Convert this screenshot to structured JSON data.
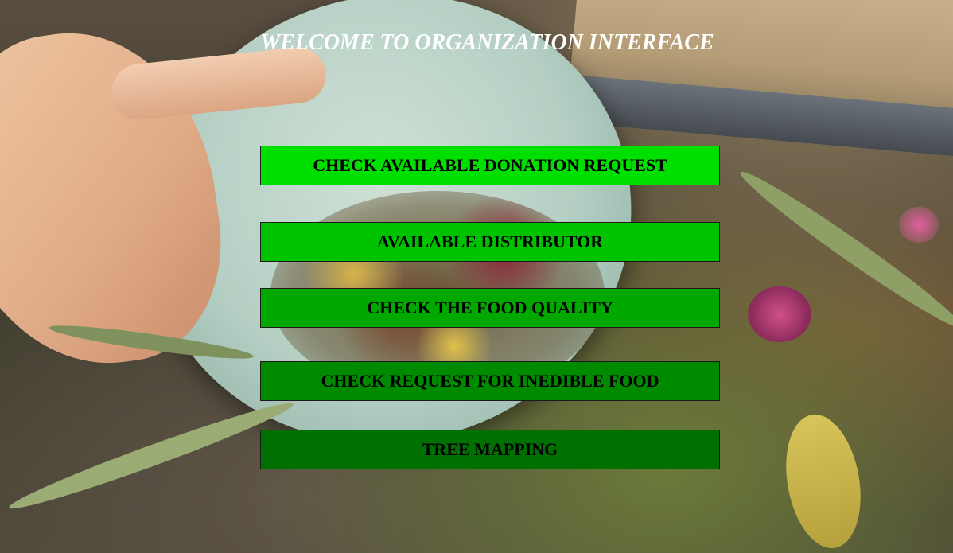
{
  "page": {
    "title": "WELCOME TO ORGANIZATION INTERFACE"
  },
  "menu": {
    "buttons": [
      {
        "label": "CHECK AVAILABLE DONATION REQUEST",
        "color": "#00e000"
      },
      {
        "label": "AVAILABLE DISTRIBUTOR",
        "color": "#00c300"
      },
      {
        "label": "CHECK THE FOOD QUALITY",
        "color": "#00a800"
      },
      {
        "label": "CHECK REQUEST FOR INEDIBLE FOOD",
        "color": "#008a00"
      },
      {
        "label": "TREE MAPPING",
        "color": "#007000"
      }
    ]
  },
  "colors": {
    "title_text": "#ffffff",
    "button_text": "#000000",
    "button_border": "#1a1a1a"
  }
}
